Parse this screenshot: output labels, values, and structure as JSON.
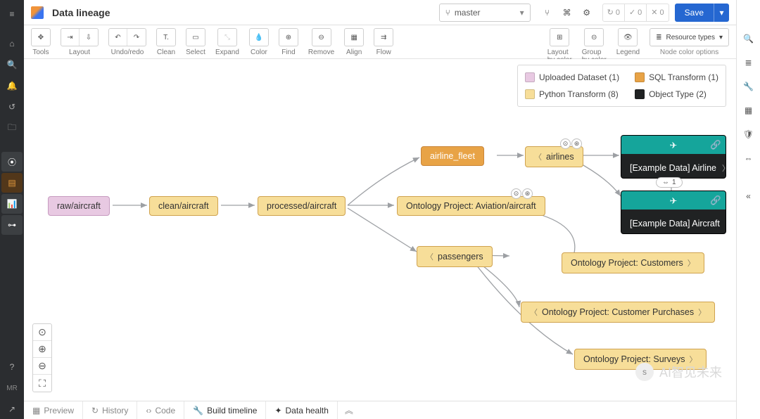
{
  "header": {
    "title": "Data lineage",
    "branch": "master",
    "save_label": "Save",
    "stats": {
      "refresh": "0",
      "ok": "0",
      "error": "0"
    }
  },
  "toolbar": {
    "groups": {
      "tools": "Tools",
      "layout": "Layout",
      "undo": "Undo/redo",
      "clean": "Clean",
      "select": "Select",
      "expand": "Expand",
      "color": "Color",
      "find": "Find",
      "remove": "Remove",
      "align": "Align",
      "flow": "Flow",
      "layout_by_color": "Layout",
      "layout_by_color_sub": "by color",
      "group_by_color": "Group",
      "group_by_color_sub": "by color",
      "legend": "Legend",
      "resource_types": "Resource types",
      "node_color": "Node color options"
    }
  },
  "legend": {
    "uploaded": "Uploaded Dataset (1)",
    "sql": "SQL Transform (1)",
    "python": "Python Transform (8)",
    "object": "Object Type (2)"
  },
  "colors": {
    "uploaded": "#e8c9e2",
    "sql": "#e8a346",
    "python": "#f7de99",
    "object": "#202223",
    "teal": "#15a59b"
  },
  "nodes": {
    "raw": "raw/aircraft",
    "clean": "clean/aircraft",
    "processed": "processed/aircraft",
    "airline_fleet": "airline_fleet",
    "airlines": "airlines",
    "ontology_aviation": "Ontology Project: Aviation/aircraft",
    "passengers": "passengers",
    "ontology_customers": "Ontology Project: Customers",
    "ontology_purchases": "Ontology Project: Customer Purchases",
    "ontology_surveys": "Ontology Project: Surveys",
    "obj_airline": "[Example Data] Airline",
    "obj_aircraft": "[Example Data] Aircraft",
    "link_count": "1"
  },
  "bottom": {
    "preview": "Preview",
    "history": "History",
    "code": "Code",
    "build": "Build timeline",
    "health": "Data health"
  },
  "misc": {
    "mr": "MR",
    "watermark": "AI智见未来"
  }
}
